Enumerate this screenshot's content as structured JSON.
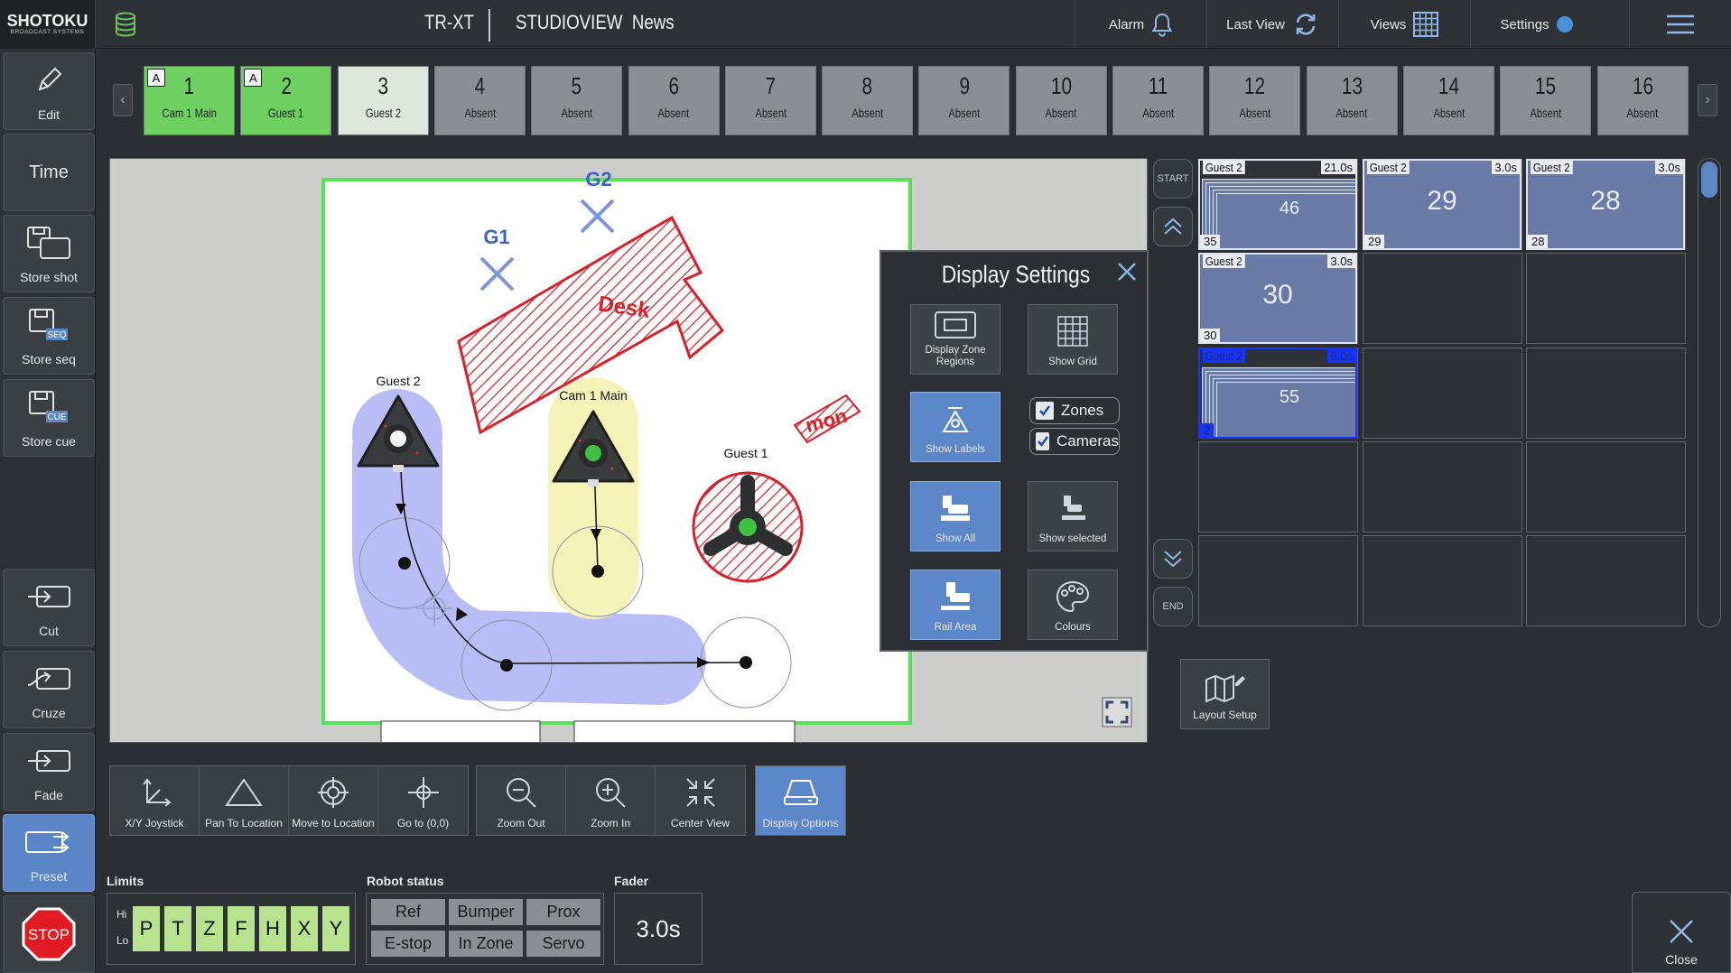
{
  "topbar": {
    "logo_main": "SHOTOKU",
    "logo_sub": "BROADCAST SYSTEMS",
    "app_title": "TR-XT",
    "studio_label": "STUDIOVIEW",
    "studio_name": "News",
    "alarm_label": "Alarm",
    "last_view_label": "Last View",
    "views_label": "Views",
    "settings_label": "Settings"
  },
  "sidebar": {
    "edit": "Edit",
    "time": "Time",
    "store_shot": "Store shot",
    "store_seq": "Store seq",
    "store_cue": "Store cue",
    "cut": "Cut",
    "cruze": "Cruze",
    "fade": "Fade",
    "preset": "Preset",
    "stop": "STOP",
    "seq_tag": "SEQ",
    "cue_tag": "CUE"
  },
  "cameras": [
    {
      "num": "1",
      "label": "Cam 1 Main",
      "state": "green",
      "badge": "A"
    },
    {
      "num": "2",
      "label": "Guest 1",
      "state": "green",
      "badge": "A"
    },
    {
      "num": "3",
      "label": "Guest 2",
      "state": "light",
      "badge": ""
    },
    {
      "num": "4",
      "label": "Absent",
      "state": "grey",
      "badge": ""
    },
    {
      "num": "5",
      "label": "Absent",
      "state": "grey",
      "badge": ""
    },
    {
      "num": "6",
      "label": "Absent",
      "state": "grey",
      "badge": ""
    },
    {
      "num": "7",
      "label": "Absent",
      "state": "grey",
      "badge": ""
    },
    {
      "num": "8",
      "label": "Absent",
      "state": "grey",
      "badge": ""
    },
    {
      "num": "9",
      "label": "Absent",
      "state": "grey",
      "badge": ""
    },
    {
      "num": "10",
      "label": "Absent",
      "state": "grey",
      "badge": ""
    },
    {
      "num": "11",
      "label": "Absent",
      "state": "grey",
      "badge": ""
    },
    {
      "num": "12",
      "label": "Absent",
      "state": "grey",
      "badge": ""
    },
    {
      "num": "13",
      "label": "Absent",
      "state": "grey",
      "badge": ""
    },
    {
      "num": "14",
      "label": "Absent",
      "state": "grey",
      "badge": ""
    },
    {
      "num": "15",
      "label": "Absent",
      "state": "grey",
      "badge": ""
    },
    {
      "num": "16",
      "label": "Absent",
      "state": "grey",
      "badge": ""
    }
  ],
  "map": {
    "g1": "G1",
    "g2": "G2",
    "desk": "Desk",
    "mon": "mon",
    "guest2_label": "Guest 2",
    "cam1_label": "Cam 1 Main",
    "guest1_label": "Guest 1"
  },
  "display_settings": {
    "title": "Display Settings",
    "display_zone_regions": "Display Zone Regions",
    "show_grid": "Show Grid",
    "show_labels": "Show Labels",
    "zones": "Zones",
    "cameras": "Cameras",
    "show_all": "Show All",
    "show_selected": "Show selected",
    "rail_area": "Rail Area",
    "colours": "Colours"
  },
  "timeline": {
    "start": "START",
    "end": "END"
  },
  "shots": [
    {
      "name": "Guest 2",
      "time": "21.0s",
      "big": "46",
      "corner": "35",
      "stacked": true,
      "selected": false
    },
    {
      "name": "Guest 2",
      "time": "3.0s",
      "big": "29",
      "corner": "29",
      "stacked": false,
      "selected": false
    },
    {
      "name": "Guest 2",
      "time": "3.0s",
      "big": "28",
      "corner": "28",
      "stacked": false,
      "selected": false
    },
    {
      "name": "Guest 2",
      "time": "3.0s",
      "big": "30",
      "corner": "30",
      "stacked": false,
      "selected": false
    },
    {
      "name": "Guest 2",
      "time": "9.0s",
      "big": "55",
      "corner": "2",
      "stacked": true,
      "selected": true
    }
  ],
  "layout_setup": "Layout Setup",
  "toolbar": {
    "xy_joystick": "X/Y Joystick",
    "pan_to_location": "Pan To Location",
    "move_to_location": "Move to Location",
    "go_to_origin": "Go to (0,0)",
    "zoom_out": "Zoom Out",
    "zoom_in": "Zoom In",
    "center_view": "Center View",
    "display_options": "Display Options"
  },
  "limits": {
    "label": "Limits",
    "hi": "Hi",
    "lo": "Lo",
    "axes": [
      "P",
      "T",
      "Z",
      "F",
      "H",
      "X",
      "Y"
    ]
  },
  "robot_status": {
    "label": "Robot status",
    "items": [
      "Ref",
      "Bumper",
      "Prox",
      "E-stop",
      "In Zone",
      "Servo"
    ]
  },
  "fader": {
    "label": "Fader",
    "value": "3.0s"
  },
  "close_label": "Close",
  "colors": {
    "accent_blue": "#5b86c7",
    "green_active": "#6fd062",
    "selection_blue": "#1733ff",
    "limit_green": "#b7e28e"
  }
}
